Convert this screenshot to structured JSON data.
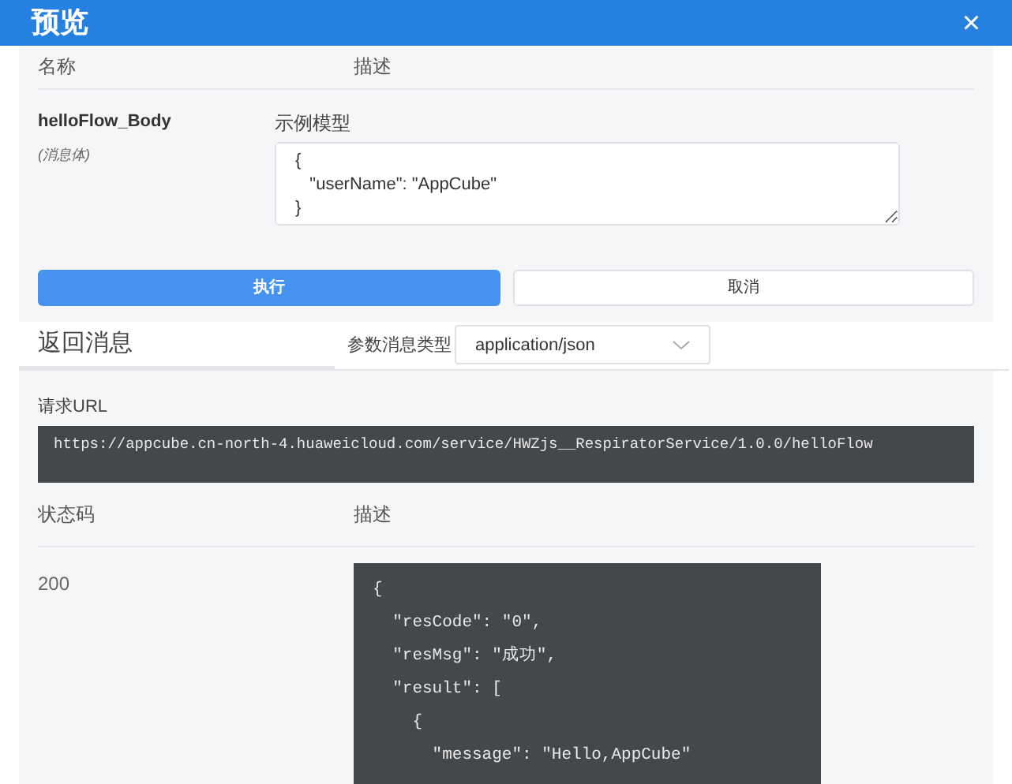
{
  "window": {
    "title": "预览",
    "close": "×"
  },
  "params": {
    "columns": [
      "名称",
      "描述"
    ],
    "name": "helloFlow_Body",
    "note": "(消息体)",
    "example_label": "示例模型",
    "example_value": "{\n   \"userName\": \"AppCube\"\n}"
  },
  "buttons": [
    {
      "label": "执行",
      "kind": "primary"
    },
    {
      "label": "取消",
      "kind": "secondary"
    }
  ],
  "tabs": [
    {
      "label": "返回消息",
      "selected": true
    }
  ],
  "content_type": {
    "label": "参数消息类型",
    "value": "application/json"
  },
  "request": {
    "label": "请求URL",
    "url": "https://appcube.cn-north-4.huaweicloud.com/service/HWZjs__RespiratorService/1.0.0/helloFlow"
  },
  "responses": {
    "columns": [
      "状态码",
      "描述"
    ],
    "status": "200",
    "body_lines": [
      "{",
      "  \"resCode\": \"0\",",
      "  \"resMsg\": \"成功\",",
      "  \"result\": [",
      "    {",
      "      \"message\": \"Hello,AppCube\""
    ]
  }
}
